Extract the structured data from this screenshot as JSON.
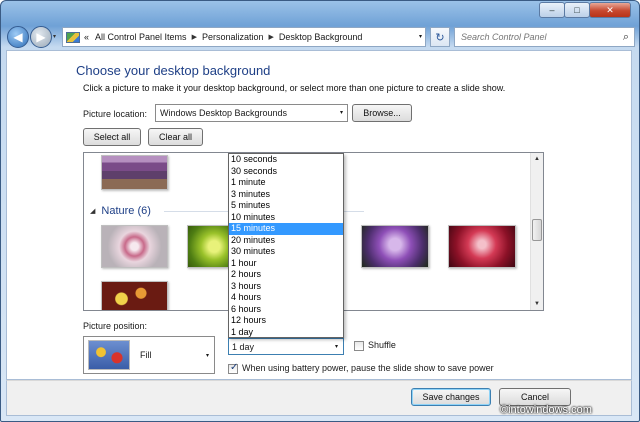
{
  "window": {
    "minimize": "–",
    "maximize": "□",
    "close": "✕"
  },
  "nav": {
    "back_icon": "◀",
    "forward_icon": "▶",
    "dropdown_icon": "▾",
    "crumbs": [
      "«",
      "All Control Panel Items",
      "Personalization",
      "Desktop Background"
    ],
    "separator": "▶",
    "refresh_icon": "↻",
    "search_placeholder": "Search Control Panel",
    "search_icon": "⌕"
  },
  "header": {
    "title": "Choose your desktop background",
    "subtitle": "Click a picture to make it your desktop background, or select more than one picture to create a slide show."
  },
  "location": {
    "label": "Picture location:",
    "value": "Windows Desktop Backgrounds",
    "browse": "Browse..."
  },
  "buttons": {
    "select_all": "Select all",
    "clear_all": "Clear all"
  },
  "gallery": {
    "category": "Nature (6)",
    "collapse_icon": "◢"
  },
  "interval": {
    "options": [
      "10 seconds",
      "30 seconds",
      "1 minute",
      "3 minutes",
      "5 minutes",
      "10 minutes",
      "15 minutes",
      "20 minutes",
      "30 minutes",
      "1 hour",
      "2 hours",
      "3 hours",
      "4 hours",
      "6 hours",
      "12 hours",
      "1 day"
    ],
    "highlighted": "15 minutes",
    "value": "1 day"
  },
  "position": {
    "label": "Picture position:",
    "value": "Fill"
  },
  "shuffle": {
    "label": "Shuffle",
    "checked": false
  },
  "battery": {
    "label": "When using battery power, pause the slide show to save power",
    "checked": true
  },
  "footer": {
    "save": "Save changes",
    "cancel": "Cancel"
  },
  "watermark": "©intowindows.com",
  "colors": {
    "title": "#1e3f86",
    "highlight": "#3399ff"
  }
}
